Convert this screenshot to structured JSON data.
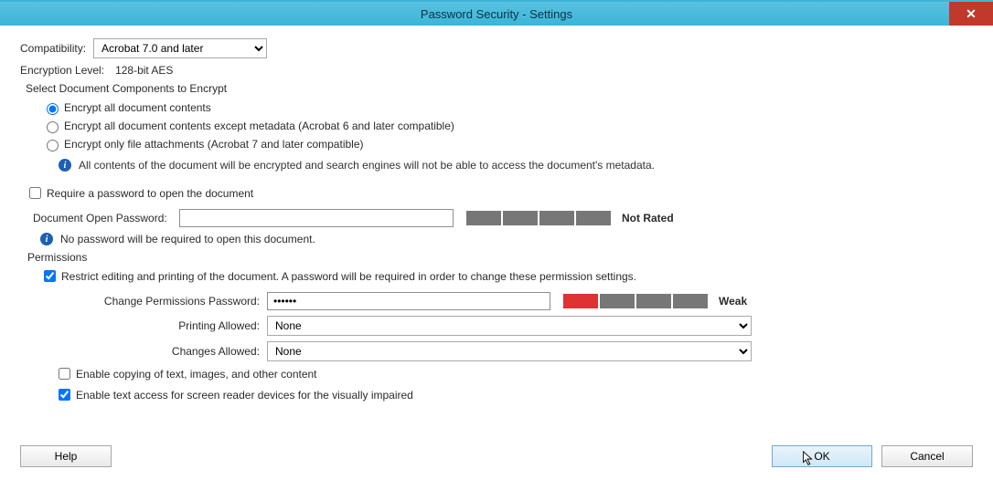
{
  "window": {
    "title": "Password Security - Settings"
  },
  "compatibility": {
    "label": "Compatibility:",
    "selected": "Acrobat 7.0 and later"
  },
  "encryption_level": {
    "label": "Encryption Level:",
    "value": "128-bit AES"
  },
  "components_group": {
    "title": "Select Document Components to Encrypt",
    "options": {
      "all": "Encrypt all document contents",
      "except_meta": "Encrypt all document contents except metadata (Acrobat 6 and later compatible)",
      "attachments": "Encrypt only file attachments (Acrobat 7 and later compatible)"
    },
    "selected": "all",
    "info": "All contents of the document will be encrypted and search engines will not be able to access the document's metadata."
  },
  "open_password": {
    "require_label": "Require a password to open the document",
    "require_checked": false,
    "field_label": "Document Open Password:",
    "value": "",
    "strength_label": "Not Rated",
    "info": "No password will be required to open this document."
  },
  "permissions": {
    "header": "Permissions",
    "restrict_label": "Restrict editing and printing of the document. A password will be required in order to change these permission settings.",
    "restrict_checked": true,
    "change_pw_label": "Change Permissions Password:",
    "change_pw_value": "******",
    "strength_label": "Weak",
    "printing_label": "Printing Allowed:",
    "printing_value": "None",
    "changes_label": "Changes Allowed:",
    "changes_value": "None",
    "copy_label": "Enable copying of text, images, and other content",
    "copy_checked": false,
    "screen_reader_label": "Enable text access for screen reader devices for the visually impaired",
    "screen_reader_checked": true
  },
  "buttons": {
    "help": "Help",
    "ok": "OK",
    "cancel": "Cancel"
  }
}
